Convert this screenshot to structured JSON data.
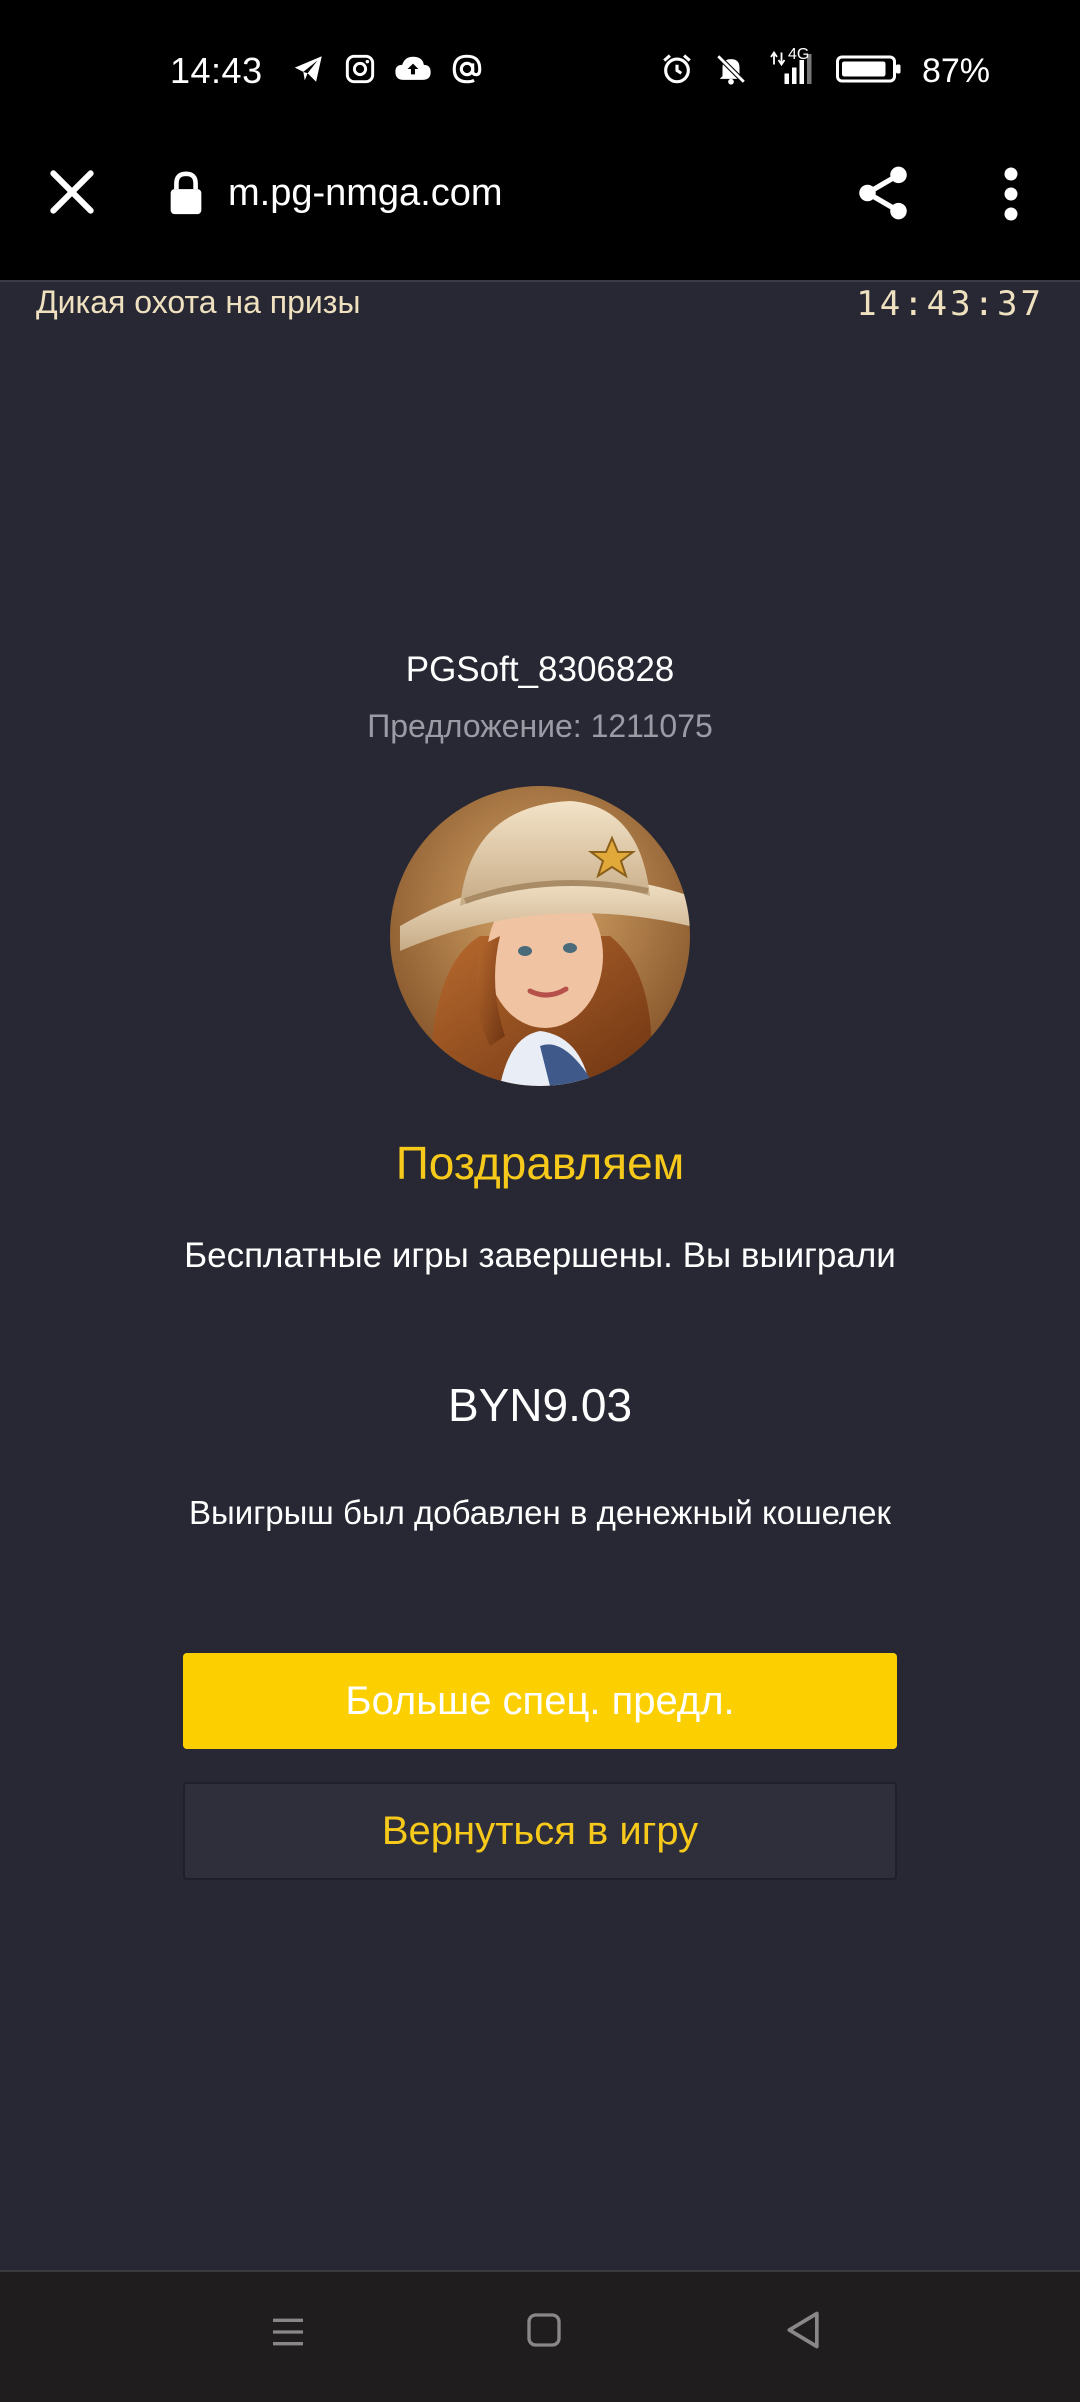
{
  "status_bar": {
    "time": "14:43",
    "network": "4G",
    "battery": "87%",
    "icons_left": [
      "telegram-icon",
      "instagram-icon",
      "cloud-upload-icon",
      "at-sign-icon"
    ],
    "icons_right": [
      "alarm-icon",
      "bell-off-icon",
      "signal-icon",
      "battery-icon"
    ]
  },
  "browser": {
    "url": "m.pg-nmga.com",
    "icons": [
      "close-icon",
      "lock-icon",
      "share-icon",
      "more-vert-icon"
    ]
  },
  "game_header": {
    "title": "Дикая охота на призы",
    "clock": "14:43:37"
  },
  "result": {
    "player_name": "PGSoft_8306828",
    "offer": "Предложение: 1211075",
    "congrats": "Поздравляем",
    "message": "Бесплатные игры завершены. Вы выиграли",
    "amount": "BYN9.03",
    "wallet_note": "Выигрыш был добавлен в денежный кошелек"
  },
  "buttons": {
    "more_offers": "Больше спец. предл.",
    "back_to_game": "Вернуться в игру"
  },
  "colors": {
    "background": "#272833",
    "accent_yellow": "#fcd000",
    "accent_text": "#f6c91a",
    "muted_text": "#9a9ba5"
  }
}
